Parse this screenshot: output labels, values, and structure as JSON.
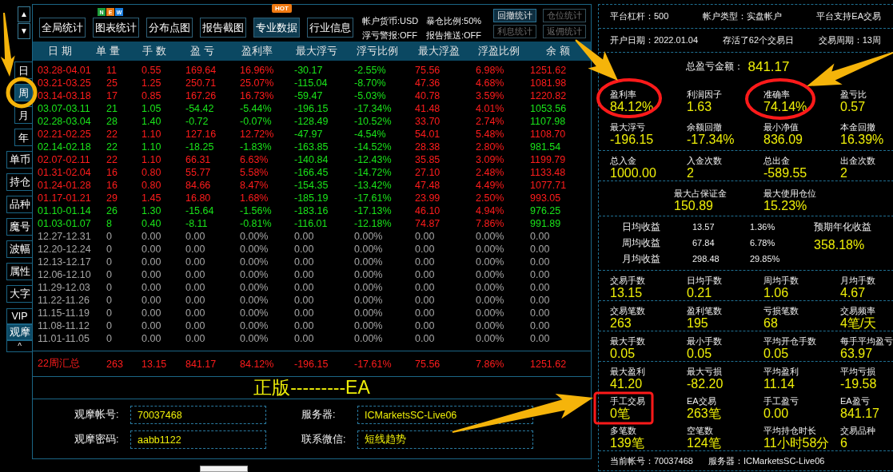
{
  "rail": {
    "arrows": [
      "▲",
      "▼"
    ],
    "period_tabs": [
      {
        "label": "日",
        "selected": false
      },
      {
        "label": "周",
        "selected": true
      },
      {
        "label": "月",
        "selected": false
      },
      {
        "label": "年",
        "selected": false
      }
    ],
    "tools": [
      "单币",
      "持仓",
      "品种",
      "魔号",
      "波幅",
      "属性",
      "大字"
    ],
    "modes": [
      {
        "label": "VIP",
        "selected": false
      },
      {
        "label": "观摩",
        "selected": true
      }
    ],
    "collapse": "^"
  },
  "toolbar": {
    "buttons": [
      {
        "label": "全局统计",
        "selected": false
      },
      {
        "label": "图表统计",
        "selected": false,
        "badge": {
          "kind": "letters",
          "letters": [
            {
              "text": "N",
              "color": "#1e9e3a"
            },
            {
              "text": "E",
              "color": "#ea7a12"
            },
            {
              "text": "W",
              "color": "#1a7ee0"
            }
          ]
        }
      },
      {
        "label": "分布点图",
        "selected": false
      },
      {
        "label": "报告截图",
        "selected": false
      },
      {
        "label": "专业数据",
        "selected": true,
        "badge": {
          "kind": "tag",
          "text": "HOT"
        }
      },
      {
        "label": "行业信息",
        "selected": false
      }
    ],
    "settings": [
      "帐户货币:USD",
      "暴仓比例:50%",
      "浮亏警报:OFF",
      "报告推送:OFF"
    ],
    "stat_buttons": [
      {
        "label": "回撤统计",
        "disabled": false
      },
      {
        "label": "仓位统计",
        "disabled": true
      },
      {
        "label": "利息统计",
        "disabled": true
      },
      {
        "label": "返佣统计",
        "disabled": true
      }
    ]
  },
  "table": {
    "columns": [
      "日 期",
      "单 量",
      "手 数",
      "盈 亏",
      "盈利率",
      "最大浮亏",
      "浮亏比例",
      "最大浮盈",
      "浮盈比例",
      "余 额"
    ],
    "rows": [
      {
        "kind": "profit",
        "cells": [
          "03.28-04.01",
          "11",
          "0.55",
          "169.64",
          "16.96%",
          "-30.17",
          "-2.55%",
          "75.56",
          "6.98%",
          "1251.62"
        ]
      },
      {
        "kind": "profit",
        "cells": [
          "03.21-03.25",
          "25",
          "1.25",
          "250.71",
          "25.07%",
          "-115.04",
          "-8.70%",
          "47.36",
          "4.68%",
          "1081.98"
        ]
      },
      {
        "kind": "profit",
        "cells": [
          "03.14-03.18",
          "17",
          "0.85",
          "167.26",
          "16.73%",
          "-59.47",
          "-5.03%",
          "40.78",
          "3.59%",
          "1220.82"
        ]
      },
      {
        "kind": "loss",
        "cells": [
          "03.07-03.11",
          "21",
          "1.05",
          "-54.42",
          "-5.44%",
          "-196.15",
          "-17.34%",
          "41.48",
          "4.01%",
          "1053.56"
        ]
      },
      {
        "kind": "loss",
        "cells": [
          "02.28-03.04",
          "28",
          "1.40",
          "-0.72",
          "-0.07%",
          "-128.49",
          "-10.52%",
          "33.70",
          "2.74%",
          "1107.98"
        ]
      },
      {
        "kind": "profit",
        "cells": [
          "02.21-02.25",
          "22",
          "1.10",
          "127.16",
          "12.72%",
          "-47.97",
          "-4.54%",
          "54.01",
          "5.48%",
          "1108.70"
        ]
      },
      {
        "kind": "loss",
        "cells": [
          "02.14-02.18",
          "22",
          "1.10",
          "-18.25",
          "-1.83%",
          "-163.85",
          "-14.52%",
          "28.38",
          "2.80%",
          "981.54"
        ]
      },
      {
        "kind": "profit",
        "cells": [
          "02.07-02.11",
          "22",
          "1.10",
          "66.31",
          "6.63%",
          "-140.84",
          "-12.43%",
          "35.85",
          "3.09%",
          "1199.79"
        ]
      },
      {
        "kind": "profit",
        "cells": [
          "01.31-02.04",
          "16",
          "0.80",
          "55.77",
          "5.58%",
          "-166.45",
          "-14.72%",
          "27.10",
          "2.48%",
          "1133.48"
        ]
      },
      {
        "kind": "profit",
        "cells": [
          "01.24-01.28",
          "16",
          "0.80",
          "84.66",
          "8.47%",
          "-154.35",
          "-13.42%",
          "47.48",
          "4.49%",
          "1077.71"
        ]
      },
      {
        "kind": "profit",
        "cells": [
          "01.17-01.21",
          "29",
          "1.45",
          "16.80",
          "1.68%",
          "-185.19",
          "-17.61%",
          "23.99",
          "2.50%",
          "993.05"
        ]
      },
      {
        "kind": "loss",
        "cells": [
          "01.10-01.14",
          "26",
          "1.30",
          "-15.64",
          "-1.56%",
          "-183.16",
          "-17.13%",
          "46.10",
          "4.94%",
          "976.25"
        ]
      },
      {
        "kind": "loss",
        "cells": [
          "01.03-01.07",
          "8",
          "0.40",
          "-8.11",
          "-0.81%",
          "-116.01",
          "-12.18%",
          "74.87",
          "7.86%",
          "991.89"
        ]
      },
      {
        "kind": "empty",
        "cells": [
          "12.27-12.31",
          "0",
          "0.00",
          "0.00",
          "0.00%",
          "0.00",
          "0.00%",
          "0.00",
          "0.00%",
          "0.00"
        ]
      },
      {
        "kind": "empty",
        "cells": [
          "12.20-12.24",
          "0",
          "0.00",
          "0.00",
          "0.00%",
          "0.00",
          "0.00%",
          "0.00",
          "0.00%",
          "0.00"
        ]
      },
      {
        "kind": "empty",
        "cells": [
          "12.13-12.17",
          "0",
          "0.00",
          "0.00",
          "0.00%",
          "0.00",
          "0.00%",
          "0.00",
          "0.00%",
          "0.00"
        ]
      },
      {
        "kind": "empty",
        "cells": [
          "12.06-12.10",
          "0",
          "0.00",
          "0.00",
          "0.00%",
          "0.00",
          "0.00%",
          "0.00",
          "0.00%",
          "0.00"
        ]
      },
      {
        "kind": "empty",
        "cells": [
          "11.29-12.03",
          "0",
          "0.00",
          "0.00",
          "0.00%",
          "0.00",
          "0.00%",
          "0.00",
          "0.00%",
          "0.00"
        ]
      },
      {
        "kind": "empty",
        "cells": [
          "11.22-11.26",
          "0",
          "0.00",
          "0.00",
          "0.00%",
          "0.00",
          "0.00%",
          "0.00",
          "0.00%",
          "0.00"
        ]
      },
      {
        "kind": "empty",
        "cells": [
          "11.15-11.19",
          "0",
          "0.00",
          "0.00",
          "0.00%",
          "0.00",
          "0.00%",
          "0.00",
          "0.00%",
          "0.00"
        ]
      },
      {
        "kind": "empty",
        "cells": [
          "11.08-11.12",
          "0",
          "0.00",
          "0.00",
          "0.00%",
          "0.00",
          "0.00%",
          "0.00",
          "0.00%",
          "0.00"
        ]
      },
      {
        "kind": "empty",
        "cells": [
          "11.01-11.05",
          "0",
          "0.00",
          "0.00",
          "0.00%",
          "0.00",
          "0.00%",
          "0.00",
          "0.00%",
          "0.00"
        ]
      }
    ],
    "summary": [
      "22周汇总",
      "263",
      "13.15",
      "841.17",
      "84.12%",
      "-196.15",
      "-17.61%",
      "75.56",
      "7.86%",
      "1251.62"
    ]
  },
  "watch_info": {
    "banner": "正版---------EA",
    "fields": [
      {
        "label": "观摩帐号:",
        "value": "70037468"
      },
      {
        "label": "服务器:",
        "value": "ICMarketsSC-Live06"
      },
      {
        "label": "观摩密码:",
        "value": "aabb1122"
      },
      {
        "label": "联系微信:",
        "value": "短线趋势"
      }
    ]
  },
  "stats_panel": {
    "info_rows": [
      [
        "平台杠杆：500",
        "帐户类型：实盘帐户",
        "平台支持EA交易"
      ],
      [
        "开户日期：2022.01.04",
        "存活了62个交易日",
        "交易周期：13周"
      ]
    ],
    "sections": [
      {
        "kind": "grid",
        "total": {
          "label": "总盈亏金额：",
          "value": "841.17"
        },
        "rows": [
          [
            {
              "label": "盈利率",
              "value": "84.12%"
            },
            {
              "label": "利润因子",
              "value": "1.63"
            },
            {
              "label": "准确率",
              "value": "74.14%"
            },
            {
              "label": "盈亏比",
              "value": "0.57"
            }
          ],
          [
            {
              "label": "最大浮亏",
              "value": "-196.15"
            },
            {
              "label": "余额回撤",
              "value": "-17.34%"
            },
            {
              "label": "最小净值",
              "value": "836.09"
            },
            {
              "label": "本金回撤",
              "value": "16.39%"
            }
          ]
        ]
      },
      {
        "kind": "grid",
        "rows": [
          [
            {
              "label": "总入金",
              "value": "1000.00"
            },
            {
              "label": "入金次数",
              "value": "2"
            },
            {
              "label": "总出金",
              "value": "-589.55"
            },
            {
              "label": "出金次数",
              "value": "2"
            }
          ]
        ]
      },
      {
        "kind": "pair",
        "rows": [
          [
            {
              "label": "最大占保证金",
              "value": "150.89"
            },
            {
              "label": "最大使用仓位",
              "value": "15.23%"
            }
          ]
        ]
      },
      {
        "kind": "income",
        "rows": [
          {
            "label": "日均收益",
            "amount": "13.57",
            "percent": "1.36%"
          },
          {
            "label": "周均收益",
            "amount": "67.84",
            "percent": "6.78%"
          },
          {
            "label": "月均收益",
            "amount": "298.48",
            "percent": "29.85%"
          }
        ],
        "forecast": {
          "label": "预期年化收益",
          "value": "358.18%"
        }
      },
      {
        "kind": "grid",
        "rows": [
          [
            {
              "label": "交易手数",
              "value": "13.15"
            },
            {
              "label": "日均手数",
              "value": "0.21"
            },
            {
              "label": "周均手数",
              "value": "1.06"
            },
            {
              "label": "月均手数",
              "value": "4.67"
            }
          ]
        ]
      },
      {
        "kind": "grid",
        "rows": [
          [
            {
              "label": "交易笔数",
              "value": "263"
            },
            {
              "label": "盈利笔数",
              "value": "195"
            },
            {
              "label": "亏损笔数",
              "value": "68"
            },
            {
              "label": "交易频率",
              "value": "4笔/天"
            }
          ]
        ]
      },
      {
        "kind": "grid",
        "rows": [
          [
            {
              "label": "最大手数",
              "value": "0.05"
            },
            {
              "label": "最小手数",
              "value": "0.05"
            },
            {
              "label": "平均开仓手数",
              "value": "0.05"
            },
            {
              "label": "每手平均盈亏",
              "value": "63.97"
            }
          ]
        ]
      },
      {
        "kind": "grid",
        "rows": [
          [
            {
              "label": "最大盈利",
              "value": "41.20"
            },
            {
              "label": "最大亏损",
              "value": "-82.20"
            },
            {
              "label": "平均盈利",
              "value": "11.14"
            },
            {
              "label": "平均亏损",
              "value": "-19.58"
            }
          ],
          [
            {
              "label": "手工交易",
              "value": "0笔"
            },
            {
              "label": "EA交易",
              "value": "263笔"
            },
            {
              "label": "手工盈亏",
              "value": "0.00"
            },
            {
              "label": "EA盈亏",
              "value": "841.17"
            }
          ],
          [
            {
              "label": "多笔数",
              "value": "139笔"
            },
            {
              "label": "空笔数",
              "value": "124笔"
            },
            {
              "label": "平均持仓时长",
              "value": "11小时58分"
            },
            {
              "label": "交易品种",
              "value": "6"
            }
          ]
        ]
      }
    ],
    "footer": [
      "当前帐号：70037468",
      "服务器：ICMarketsSC-Live06"
    ]
  }
}
